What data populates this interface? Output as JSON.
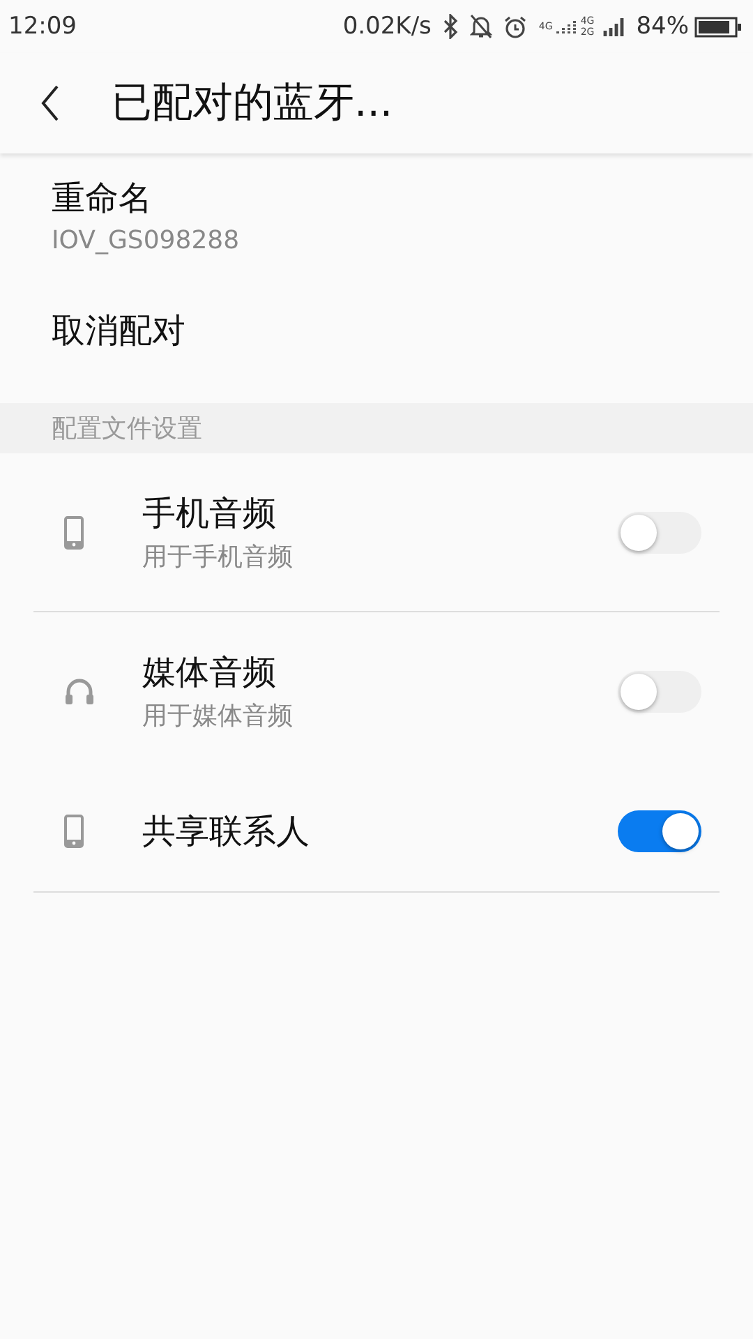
{
  "status_bar": {
    "time": "12:09",
    "speed": "0.02K/s",
    "network_labels": [
      "4G",
      "4G",
      "2G"
    ],
    "battery": "84%"
  },
  "app_bar": {
    "title": "已配对的蓝牙..."
  },
  "rename": {
    "label": "重命名",
    "value": "IOV_GS098288"
  },
  "unpair": {
    "label": "取消配对"
  },
  "section": {
    "title": "配置文件设置"
  },
  "profiles": [
    {
      "kind": "phone",
      "title": "手机音频",
      "subtitle": "用于手机音频",
      "on": false,
      "divider": true
    },
    {
      "kind": "headphones",
      "title": "媒体音频",
      "subtitle": "用于媒体音频",
      "on": false,
      "divider": false
    },
    {
      "kind": "phone",
      "title": "共享联系人",
      "on": true,
      "divider": true
    }
  ]
}
